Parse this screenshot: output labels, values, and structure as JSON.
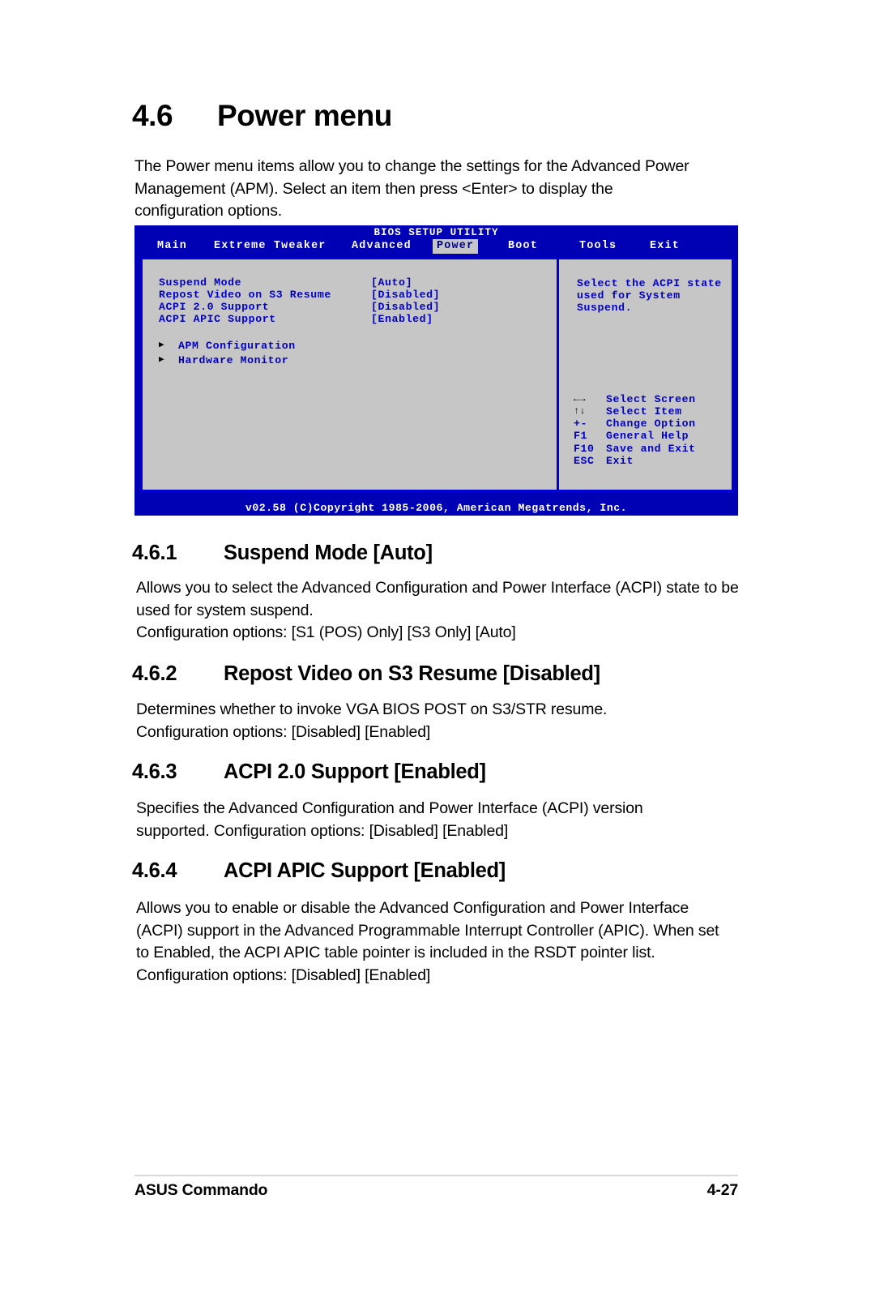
{
  "heading": {
    "number": "4.6",
    "title": "Power menu"
  },
  "intro": "The Power menu items allow you to change the settings for the Advanced Power Management (APM). Select an item then press <Enter> to display the configuration options.",
  "bios": {
    "title": "BIOS SETUP UTILITY",
    "tabs": [
      {
        "label": "Main",
        "active": false
      },
      {
        "label": "Extreme Tweaker",
        "active": false
      },
      {
        "label": "Advanced",
        "active": false
      },
      {
        "label": "Power",
        "active": true
      },
      {
        "label": "Boot",
        "active": false
      },
      {
        "label": "Tools",
        "active": false
      },
      {
        "label": "Exit",
        "active": false
      }
    ],
    "items": [
      {
        "label": "Suspend Mode",
        "value": "[Auto]"
      },
      {
        "label": "Repost Video on S3 Resume",
        "value": "[Disabled]"
      },
      {
        "label": "ACPI 2.0 Support",
        "value": "[Disabled]"
      },
      {
        "label": "ACPI APIC Support",
        "value": "[Enabled]"
      }
    ],
    "submenus": [
      {
        "marker": "▶",
        "label": "APM Configuration"
      },
      {
        "marker": "▶",
        "label": "Hardware Monitor"
      }
    ],
    "help": "Select the ACPI state used for System Suspend.",
    "legend": [
      {
        "key": "←→",
        "desc": "Select Screen",
        "glyph": true
      },
      {
        "key": "↑↓",
        "desc": "Select Item",
        "glyph": true
      },
      {
        "key": "+-",
        "desc": "Change Option",
        "glyph": false
      },
      {
        "key": "F1",
        "desc": "General Help",
        "glyph": false
      },
      {
        "key": "F10",
        "desc": "Save and Exit",
        "glyph": false
      },
      {
        "key": "ESC",
        "desc": "Exit",
        "glyph": false
      }
    ],
    "footer": "v02.58 (C)Copyright 1985-2006, American Megatrends, Inc.",
    "colors": {
      "screen_blue": "#0000b4",
      "panel_gray": "#c6c6c6",
      "text_blue": "#0000c8",
      "border_blue": "#0000d2"
    }
  },
  "sections": [
    {
      "number": "4.6.1",
      "title": "Suspend Mode [Auto]",
      "body": "Allows you to select the Advanced Configuration and Power Interface (ACPI) state to be used for system suspend.\nConfiguration options: [S1 (POS) Only] [S3 Only] [Auto]"
    },
    {
      "number": "4.6.2",
      "title": "Repost Video on S3 Resume [Disabled]",
      "body": "Determines whether to invoke VGA BIOS POST on S3/STR resume.\nConfiguration options: [Disabled] [Enabled]"
    },
    {
      "number": "4.6.3",
      "title": "ACPI 2.0 Support [Enabled]",
      "body": "Specifies the Advanced Configuration and Power Interface (ACPI) version supported. Configuration options: [Disabled] [Enabled]"
    },
    {
      "number": "4.6.4",
      "title": "ACPI APIC Support [Enabled]",
      "body": "Allows you to enable or disable the Advanced Configuration and Power Interface (ACPI) support in the Advanced Programmable Interrupt Controller (APIC). When set to Enabled, the ACPI APIC table pointer is included in the RSDT pointer list. Configuration options: [Disabled] [Enabled]"
    }
  ],
  "footer": {
    "left": "ASUS Commando",
    "right": "4-27"
  }
}
